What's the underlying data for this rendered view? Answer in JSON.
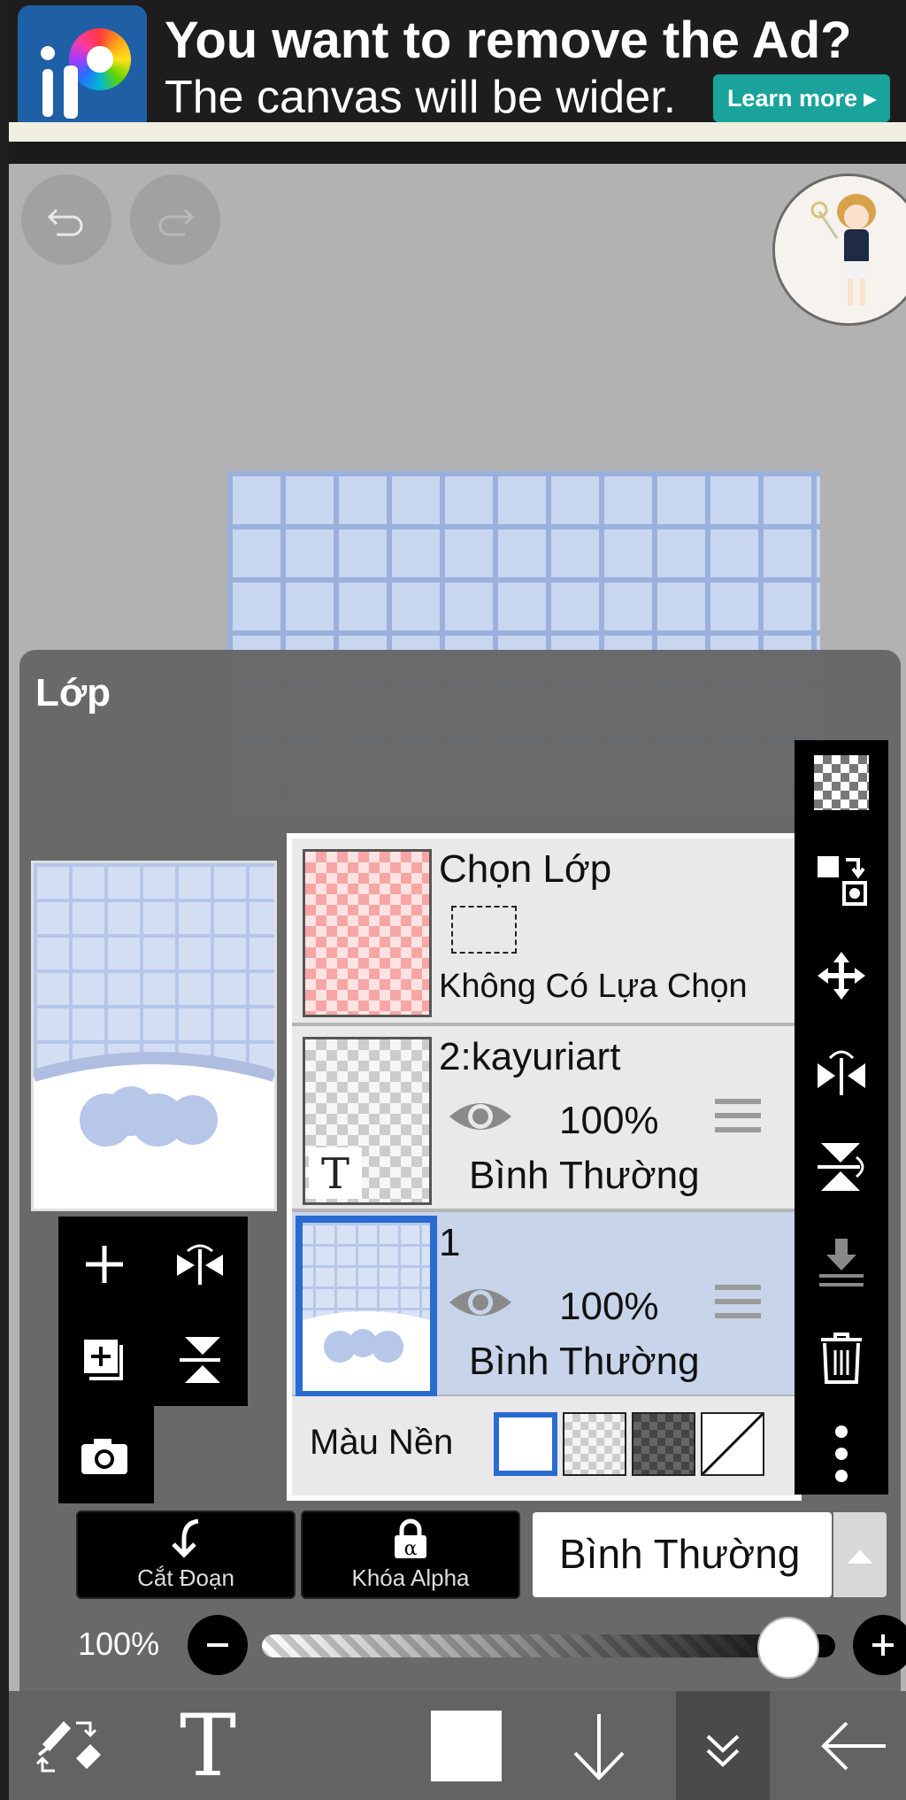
{
  "ad": {
    "title": "You want to remove the Ad?",
    "subtitle": "The canvas will be wider.",
    "button": "Learn more ▸"
  },
  "panel": {
    "title": "Lớp"
  },
  "layers": {
    "selection": {
      "name": "Chọn Lớp",
      "note": "Không Có Lựa Chọn"
    },
    "items": [
      {
        "name": "2:kayuriart",
        "opacity": "100%",
        "blend": "Bình Thường",
        "badge": "T"
      },
      {
        "name": "1",
        "opacity": "100%",
        "blend": "Bình Thường"
      }
    ],
    "background_label": "Màu Nền"
  },
  "controls": {
    "cut_label": "Cắt Đoạn",
    "alpha_label": "Khóa Alpha",
    "alpha_icon_glyph": "α",
    "blend_mode": "Bình Thường",
    "opacity_label": "100%",
    "opacity_value": 1.0
  },
  "toolbar": {
    "text_glyph": "T"
  },
  "colors": {
    "accent": "#2a6bd1",
    "ad_button": "#1aa39a",
    "panel": "#666666",
    "selected_row": "#c7d4ea"
  }
}
